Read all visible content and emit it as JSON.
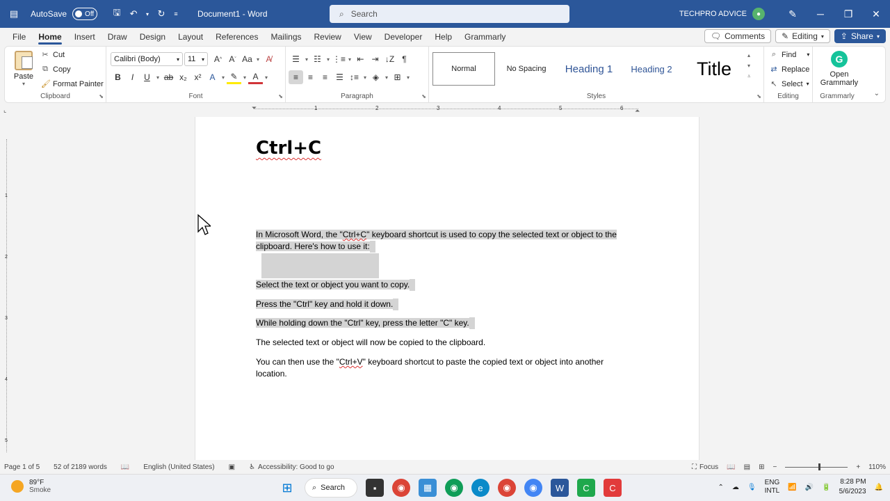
{
  "titlebar": {
    "autosave_label": "AutoSave",
    "autosave_state": "Off",
    "doc_title": "Document1  -  Word",
    "search_placeholder": "Search",
    "account_name": "TECHPRO ADVICE"
  },
  "menu": {
    "tabs": [
      "File",
      "Home",
      "Insert",
      "Draw",
      "Design",
      "Layout",
      "References",
      "Mailings",
      "Review",
      "View",
      "Developer",
      "Help",
      "Grammarly"
    ],
    "active_tab": "Home",
    "comments": "Comments",
    "editing": "Editing",
    "share": "Share"
  },
  "ribbon": {
    "clipboard": {
      "paste": "Paste",
      "cut": "Cut",
      "copy": "Copy",
      "format_painter": "Format Painter",
      "label": "Clipboard"
    },
    "font": {
      "name": "Calibri (Body)",
      "size": "11",
      "label": "Font"
    },
    "paragraph": {
      "label": "Paragraph"
    },
    "styles": {
      "items": [
        "Normal",
        "No Spacing",
        "Heading 1",
        "Heading 2",
        "Title"
      ],
      "label": "Styles"
    },
    "editing": {
      "find": "Find",
      "replace": "Replace",
      "select": "Select",
      "label": "Editing"
    },
    "grammarly": {
      "open1": "Open",
      "open2": "Grammarly",
      "label": "Grammarly"
    }
  },
  "ruler": {
    "h_numbers": [
      "1",
      "2",
      "3",
      "4",
      "5",
      "6"
    ],
    "v_numbers": [
      "1",
      "2",
      "3",
      "4",
      "5"
    ]
  },
  "document": {
    "heading": "Ctrl+C",
    "p1a": "In Microsoft Word, the \"",
    "p1b": "Ctrl+C",
    "p1c": "\" keyboard shortcut is used to copy the selected text or object to the",
    "p1d": "clipboard. Here's how to use it:",
    "step1": "Select the text or object you want to copy.",
    "step2": "Press the \"Ctrl\" key and hold it down.",
    "step3": "While holding down the \"Ctrl\" key, press the letter \"C\" key.",
    "step4": "The selected text or object will now be copied to the clipboard.",
    "p2a": "You can then use the \"",
    "p2b": "Ctrl+V",
    "p2c": "\" keyboard shortcut to paste the copied text or object into another",
    "p2d": "location."
  },
  "status": {
    "page": "Page 1 of 5",
    "words": "52 of 2189 words",
    "language": "English (United States)",
    "accessibility": "Accessibility: Good to go",
    "focus": "Focus",
    "zoom": "110%"
  },
  "taskbar": {
    "temp": "89°F",
    "weather": "Smoke",
    "search": "Search",
    "lang1": "ENG",
    "lang2": "INTL",
    "time": "8:28 PM",
    "date": "5/6/2023"
  },
  "colors": {
    "word_blue": "#2b579a",
    "selection": "#d4d4d4",
    "grammarly": "#15c39a"
  }
}
